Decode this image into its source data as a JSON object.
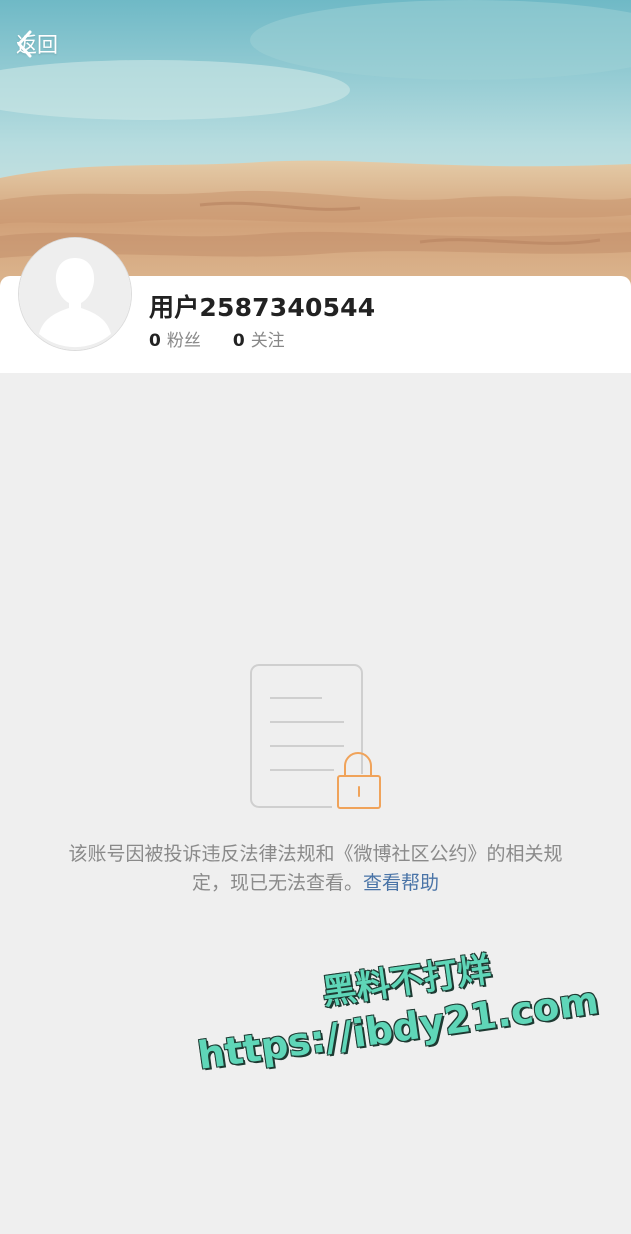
{
  "nav": {
    "back_label": "返回"
  },
  "profile": {
    "username": "用户2587340544",
    "followers_count": "0",
    "followers_label": "粉丝",
    "following_count": "0",
    "following_label": "关注"
  },
  "notice": {
    "text": "该账号因被投诉违反法律法规和《微博社区公约》的相关规定，现已无法查看。",
    "help_link": "查看帮助"
  },
  "watermark": {
    "line1": "黑料不打烊",
    "line2": "https://ibdy21.com"
  },
  "colors": {
    "background": "#efefef",
    "card": "#ffffff",
    "link": "#4a74a7",
    "lock_accent": "#f0a35a",
    "watermark": "#5fd6b8"
  },
  "icons": [
    "chevron-left-icon",
    "default-avatar-icon",
    "locked-document-icon"
  ]
}
